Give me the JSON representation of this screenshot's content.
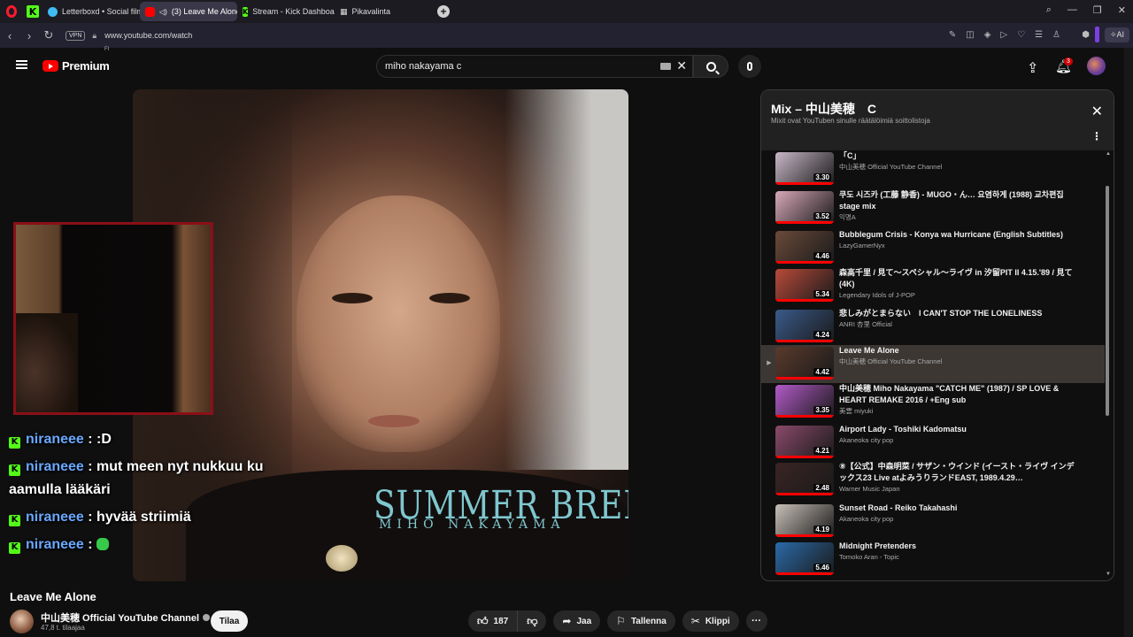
{
  "browser": {
    "tabs": [
      {
        "label": "Letterboxd • Social film di",
        "favicon_color": "#40bcf4"
      },
      {
        "label": "(3) Leave Me Alone -",
        "favicon_color": "#ff0000",
        "active": true
      },
      {
        "label": "Stream - Kick Dashboard",
        "favicon_color": "#53fc18"
      },
      {
        "label": "Pikavalinta",
        "favicon_color": "#aaaaaa"
      }
    ],
    "vpn_label": "VPN",
    "url": "www.youtube.com/watch",
    "ai_label": "AI"
  },
  "youtube": {
    "logo_text": "Premium",
    "region": "FI",
    "search_value": "miho nakayama c",
    "notification_count": "3"
  },
  "video": {
    "album_title": "SUMMER BREEZE",
    "album_artist": "MIHO NAKAYAMA",
    "title": "Leave Me Alone",
    "channel": "中山美穂 Official YouTube Channel",
    "subscribers": "47,8 t. tilaajaa",
    "subscribe_label": "Tilaa",
    "likes": "187",
    "share_label": "Jaa",
    "save_label": "Tallenna",
    "clip_label": "Klippi"
  },
  "chat": [
    {
      "user": "niraneee",
      "message": ": :D"
    },
    {
      "user": "niraneee",
      "message": ": mut meen nyt nukkuu ku aamulla lääkäri"
    },
    {
      "user": "niraneee",
      "message": ": hyvää striimiä"
    },
    {
      "user": "niraneee",
      "message": ":",
      "emote": true
    }
  ],
  "mix": {
    "title": "Mix – 中山美穂　C",
    "subtitle": "Mixit ovat YouTuben sinulle räätälöimiä soittolistoja",
    "items": [
      {
        "title": "「C」",
        "channel": "中山美穂 Official YouTube Channel",
        "duration": "3.30",
        "thumb": "#c9b8c8"
      },
      {
        "title": "쿠도 시즈카 (工藤 静香) - MUGO・ん… 요염하게 (1988) 교차편집 stage mix",
        "channel": "익명A",
        "duration": "3.52",
        "thumb": "#d8a8b8"
      },
      {
        "title": "Bubblegum Crisis - Konya wa Hurricane (English Subtitles)",
        "channel": "LazyGamerNyx",
        "duration": "4.46",
        "thumb": "#6a4a3a"
      },
      {
        "title": "森高千里 / 見て〜スペシャル〜ライヴ in 汐留PIT II 4.15.'89 / 見て (4K)",
        "channel": "Legendary Idols of J-POP",
        "duration": "5.34",
        "thumb": "#b84a3a"
      },
      {
        "title": "悲しみがとまらない　I CAN'T STOP THE LONELINESS",
        "channel": "ANRI 杏里 Official",
        "duration": "4.24",
        "thumb": "#3a5a8a"
      },
      {
        "title": "Leave Me Alone",
        "channel": "中山美穂 Official YouTube Channel",
        "duration": "4.42",
        "thumb": "#5a3a2c",
        "current": true
      },
      {
        "title": "中山美穂 Miho Nakayama \"CATCH ME\" (1987) / SP LOVE & HEART REMAKE 2016 / +Eng sub",
        "channel": "美雲 miyuki",
        "duration": "3.35",
        "thumb": "#b35ac8"
      },
      {
        "title": "Airport Lady - Toshiki Kadomatsu",
        "channel": "Akaneoka city pop",
        "duration": "4.21",
        "thumb": "#8a4a6a"
      },
      {
        "title": "⑧【公式】中森明菜 / サザン・ウインド (イースト・ライヴ インデックス23 Live atよみうりランドEAST, 1989.4.29…",
        "channel": "Warner Music Japan",
        "duration": "2.48",
        "thumb": "#3a2424"
      },
      {
        "title": "Sunset Road - Reiko Takahashi",
        "channel": "Akaneoka city pop",
        "duration": "4.19",
        "thumb": "#c8c0b8"
      },
      {
        "title": "Midnight Pretenders",
        "channel": "Tomoko Aran - Topic",
        "duration": "5.46",
        "thumb": "#2a6aa8"
      }
    ]
  }
}
